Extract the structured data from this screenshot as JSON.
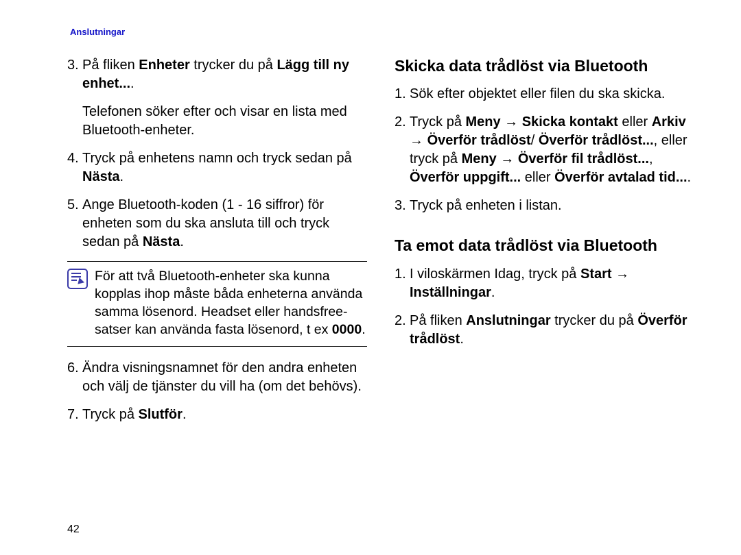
{
  "header": "Anslutningar",
  "page_number": "42",
  "left": {
    "step3_num": "3.",
    "step3_text_a": "På fliken ",
    "step3_text_b": "Enheter",
    "step3_text_c": " trycker du på ",
    "step3_text_d": "Lägg till ny enhet...",
    "step3_text_e": ".",
    "step3_sub": "Telefonen söker efter och visar en lista med Bluetooth-enheter.",
    "step4_num": "4.",
    "step4_text_a": "Tryck på enhetens namn och tryck sedan på ",
    "step4_text_b": "Nästa",
    "step4_text_c": ".",
    "step5_num": "5.",
    "step5_text_a": "Ange Bluetooth-koden (1 - 16 siffror) för enheten som du ska ansluta till och tryck sedan på ",
    "step5_text_b": "Nästa",
    "step5_text_c": ".",
    "note_a": "För att två Bluetooth-enheter ska kunna kopplas ihop måste båda enheterna använda samma lösenord. Headset eller handsfree-satser kan använda fasta lösenord, t ex ",
    "note_b": "0000",
    "note_c": ".",
    "step6_num": "6.",
    "step6_text": "Ändra visningsnamnet för den andra enheten och välj de tjänster du vill ha (om det behövs).",
    "step7_num": "7.",
    "step7_text_a": "Tryck på ",
    "step7_text_b": "Slutför",
    "step7_text_c": "."
  },
  "right": {
    "h1": "Skicka data trådlöst via Bluetooth",
    "s1_num": "1.",
    "s1_text": "Sök efter objektet eller filen du ska skicka.",
    "s2_num": "2.",
    "s2_a": "Tryck på ",
    "s2_b": "Meny",
    "s2_c": " → ",
    "s2_d": "Skicka kontakt",
    "s2_e": " eller ",
    "s2_f": "Arkiv",
    "s2_g": " → ",
    "s2_h": "Överför trådlöst",
    "s2_i": "/ ",
    "s2_j": "Överför trådlöst...",
    "s2_k": ", eller tryck på ",
    "s2_l": "Meny",
    "s2_m": " → ",
    "s2_n": "Överför fil trådlöst...",
    "s2_o": ", ",
    "s2_p": "Överför uppgift...",
    "s2_q": " eller ",
    "s2_r": "Överför avtalad tid...",
    "s2_s": ".",
    "s3_num": "3.",
    "s3_text": "Tryck på enheten i listan.",
    "h2": "Ta emot data trådlöst via Bluetooth",
    "r1_num": "1.",
    "r1_a": "I viloskärmen Idag, tryck på ",
    "r1_b": "Start",
    "r1_c": " → ",
    "r1_d": "Inställningar",
    "r1_e": ".",
    "r2_num": "2.",
    "r2_a": "På fliken ",
    "r2_b": "Anslutningar",
    "r2_c": " trycker du på ",
    "r2_d": "Överför trådlöst",
    "r2_e": "."
  }
}
